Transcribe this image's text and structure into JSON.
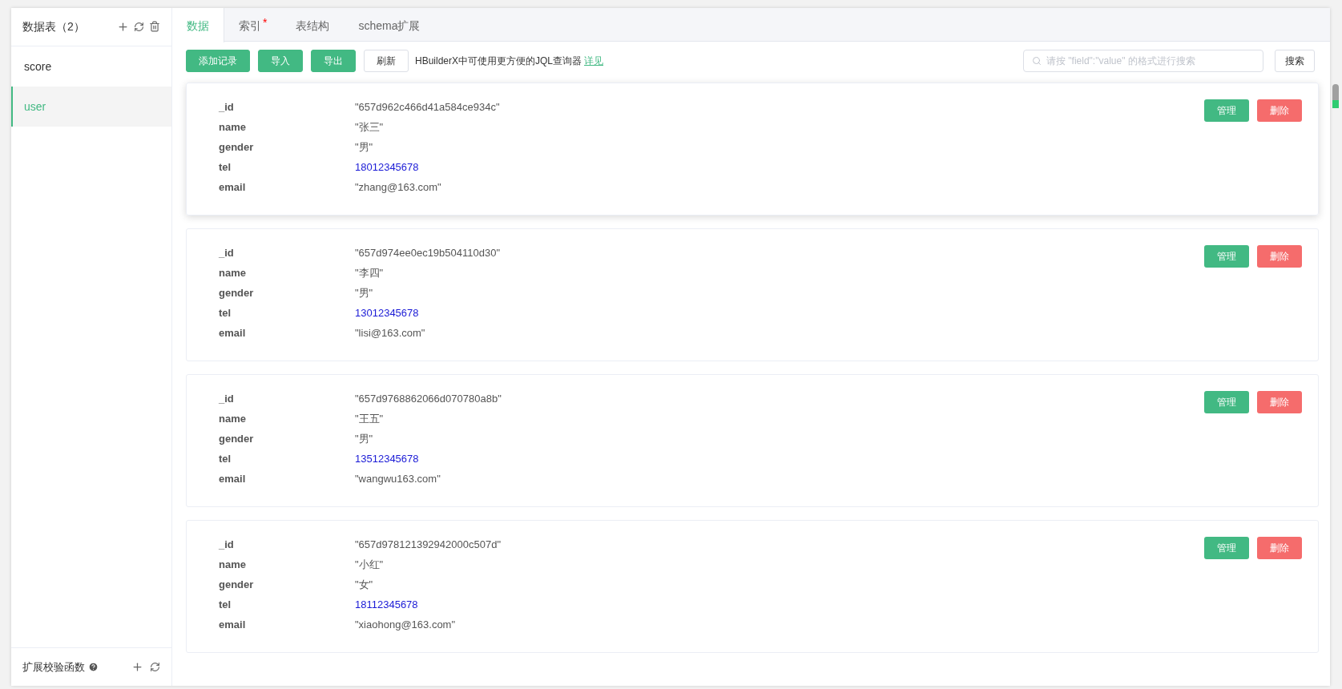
{
  "sidebar": {
    "title": "数据表（2）",
    "items": [
      {
        "label": "score",
        "selected": false
      },
      {
        "label": "user",
        "selected": true
      }
    ],
    "footer": {
      "title": "扩展校验函数"
    }
  },
  "tabs": [
    {
      "label": "数据",
      "selected": true
    },
    {
      "label": "索引",
      "selected": false,
      "mark": "*"
    },
    {
      "label": "表结构",
      "selected": false
    },
    {
      "label": "schema扩展",
      "selected": false
    }
  ],
  "toolbar": {
    "buttons": [
      {
        "label": "添加记录",
        "kind": "primary"
      },
      {
        "label": "导入",
        "kind": "primary"
      },
      {
        "label": "导出",
        "kind": "primary"
      },
      {
        "label": "刷新",
        "kind": "plain"
      }
    ],
    "hint": "HBuilderX中可使用更方便的JQL查询器",
    "hint_link": "详见",
    "search": {
      "placeholder": "请按 \"field\":\"value\" 的格式进行搜索"
    },
    "search_button": "搜索"
  },
  "records": [
    {
      "hovered": true,
      "fields": [
        {
          "key": "_id",
          "value": "\"657d962c466d41a584ce934c\"",
          "kind": "string"
        },
        {
          "key": "name",
          "value": "\"张三\"",
          "kind": "string"
        },
        {
          "key": "gender",
          "value": "\"男\"",
          "kind": "string"
        },
        {
          "key": "tel",
          "value": "18012345678",
          "kind": "number"
        },
        {
          "key": "email",
          "value": "\"zhang@163.com\"",
          "kind": "string"
        }
      ],
      "manage": "管理",
      "delete": "删除"
    },
    {
      "hovered": false,
      "fields": [
        {
          "key": "_id",
          "value": "\"657d974ee0ec19b504110d30\"",
          "kind": "string"
        },
        {
          "key": "name",
          "value": "\"李四\"",
          "kind": "string"
        },
        {
          "key": "gender",
          "value": "\"男\"",
          "kind": "string"
        },
        {
          "key": "tel",
          "value": "13012345678",
          "kind": "number"
        },
        {
          "key": "email",
          "value": "\"lisi@163.com\"",
          "kind": "string"
        }
      ],
      "manage": "管理",
      "delete": "删除"
    },
    {
      "hovered": false,
      "fields": [
        {
          "key": "_id",
          "value": "\"657d9768862066d070780a8b\"",
          "kind": "string"
        },
        {
          "key": "name",
          "value": "\"王五\"",
          "kind": "string"
        },
        {
          "key": "gender",
          "value": "\"男\"",
          "kind": "string"
        },
        {
          "key": "tel",
          "value": "13512345678",
          "kind": "number"
        },
        {
          "key": "email",
          "value": "\"wangwu163.com\"",
          "kind": "string"
        }
      ],
      "manage": "管理",
      "delete": "删除"
    },
    {
      "hovered": false,
      "fields": [
        {
          "key": "_id",
          "value": "\"657d978121392942000c507d\"",
          "kind": "string"
        },
        {
          "key": "name",
          "value": "\"小红\"",
          "kind": "string"
        },
        {
          "key": "gender",
          "value": "\"女\"",
          "kind": "string"
        },
        {
          "key": "tel",
          "value": "18112345678",
          "kind": "number"
        },
        {
          "key": "email",
          "value": "\"xiaohong@163.com\"",
          "kind": "string"
        }
      ],
      "manage": "管理",
      "delete": "删除"
    }
  ]
}
